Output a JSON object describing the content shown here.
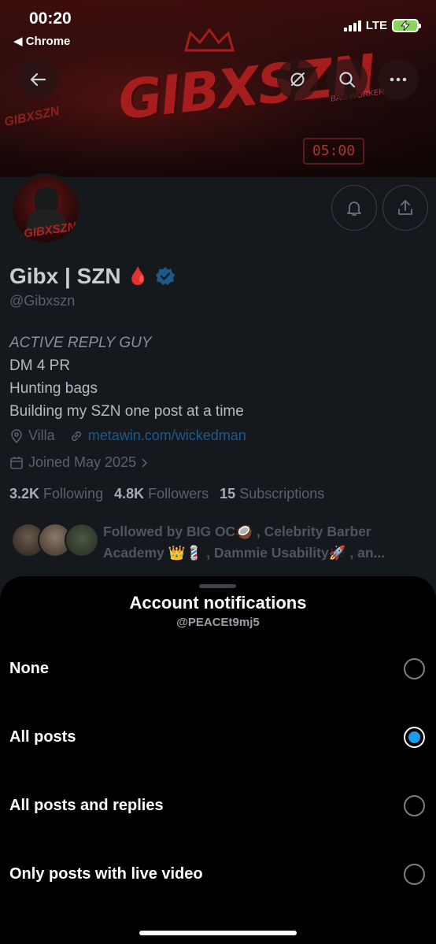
{
  "status_bar": {
    "time": "00:20",
    "back_app": "◀ Chrome",
    "network": "LTE"
  },
  "banner": {
    "logo_text": "GIBXSZN",
    "clock_text": "05:00",
    "tag_text": "GIBXSZN",
    "side_text": "BAG WORKER"
  },
  "avatar": {
    "text": "GIBXSZN"
  },
  "profile": {
    "name": "Gibx | SZN",
    "emoji": "🩸",
    "handle": "@Gibxszn",
    "bio_italic": "ACTIVE REPLY GUY",
    "bio_lines": [
      "DM 4 PR",
      "Hunting bags",
      "Building my SZN one post at a time"
    ],
    "location": "Villa",
    "website": "metawin.com/wickedman",
    "joined": "Joined May 2025",
    "following_count": "3.2K",
    "following_label": "Following",
    "followers_count": "4.8K",
    "followers_label": "Followers",
    "subscriptions_count": "15",
    "subscriptions_label": "Subscriptions",
    "followed_by_line1": "Followed by BIG OC🥥 , Celebrity Barber",
    "followed_by_line2": "Academy 👑💈 , Dammie Usability🚀 , an..."
  },
  "sheet": {
    "title": "Account notifications",
    "subtitle": "@PEACEt9mj5",
    "options": [
      {
        "label": "None",
        "selected": false
      },
      {
        "label": "All posts",
        "selected": true
      },
      {
        "label": "All posts and replies",
        "selected": false
      },
      {
        "label": "Only posts with live video",
        "selected": false
      }
    ]
  },
  "colors": {
    "accent": "#1d9bf0",
    "sheet_bg": "#000000",
    "page_bg": "#15181c"
  }
}
